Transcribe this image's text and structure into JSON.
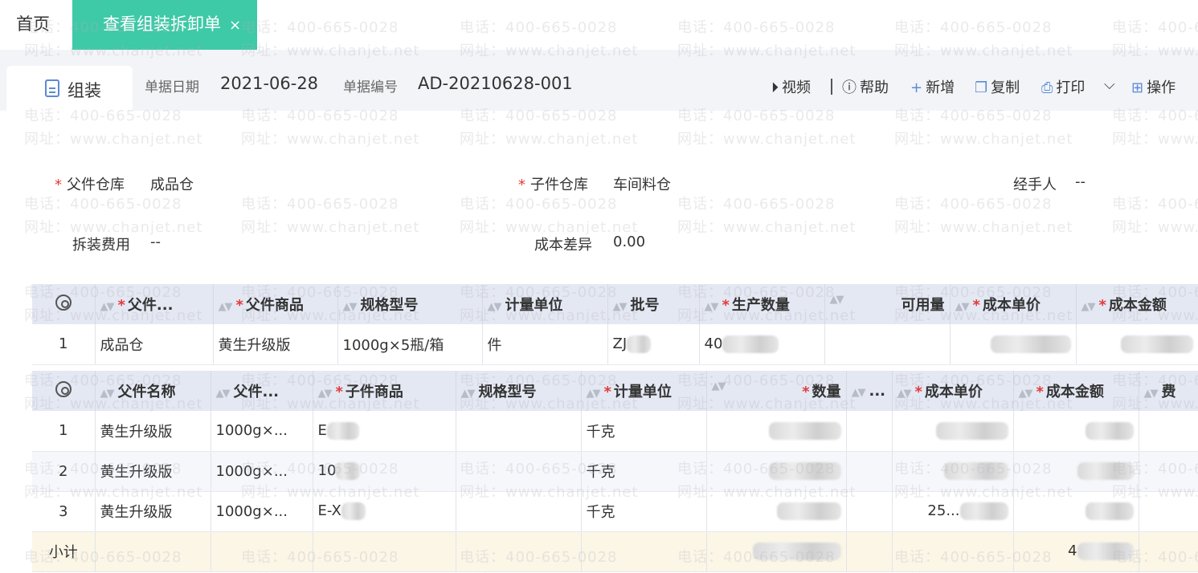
{
  "tabs": {
    "home_label": "首页",
    "active_label": "查看组装拆卸单",
    "close_glyph": "×"
  },
  "toolbar": {
    "mode_label": "组装",
    "date_label": "单据日期",
    "date_value": "2021-06-28",
    "number_label": "单据编号",
    "number_value": "AD-20210628-001",
    "video_label": "视频",
    "help_label": "帮助",
    "add_label": "新增",
    "copy_label": "复制",
    "print_label": "打印",
    "action_label": "操作"
  },
  "form": {
    "parent_wh_label": "父件仓库",
    "parent_wh_value": "成品仓",
    "child_wh_label": "子件仓库",
    "child_wh_value": "车间料仓",
    "handler_label": "经手人",
    "handler_value": "--",
    "disassembly_fee_label": "拆装费用",
    "disassembly_fee_value": "--",
    "cost_diff_label": "成本差异",
    "cost_diff_value": "0.00"
  },
  "parent_table": {
    "headers": [
      "父件...",
      "父件商品",
      "规格型号",
      "计量单位",
      "批号",
      "生产数量",
      "可用量",
      "成本单价",
      "成本金额"
    ],
    "rows": [
      {
        "idx": "1",
        "wh": "成品仓",
        "product": "黄生升级版",
        "spec": "1000g×5瓶/箱",
        "unit": "件",
        "batch": "ZJ",
        "qty": "40"
      }
    ]
  },
  "child_table": {
    "headers": [
      "父件名称",
      "父件...",
      "子件商品",
      "规格型号",
      "计量单位",
      "数量",
      "...",
      "成本单价",
      "成本金额",
      "费"
    ],
    "rows": [
      {
        "idx": "1",
        "parent": "黄生升级版",
        "parent_spec": "1000g×...",
        "item": "E",
        "unit": "千克"
      },
      {
        "idx": "2",
        "parent": "黄生升级版",
        "parent_spec": "1000g×...",
        "item": "10",
        "unit": "千克"
      },
      {
        "idx": "3",
        "parent": "黄生升级版",
        "parent_spec": "1000g×...",
        "item": "E-X",
        "unit": "千克",
        "unit_price": "25..."
      }
    ],
    "subtotal_label": "小计",
    "subtotal_amount": "4"
  },
  "watermark": {
    "phone": "电话：400-665-0028",
    "site": "网址：www.chanjet.net"
  }
}
